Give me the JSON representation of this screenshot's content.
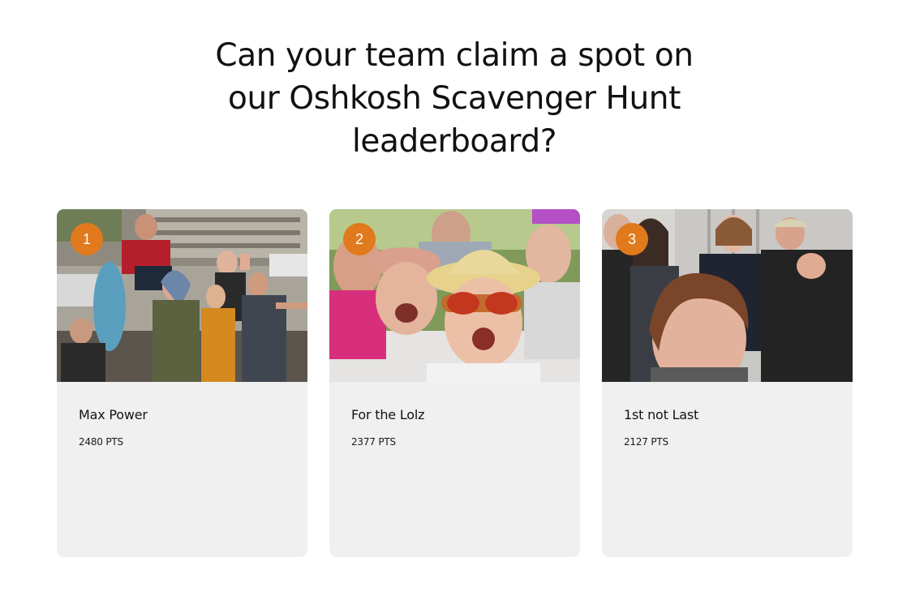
{
  "heading": {
    "line1": "Can your team claim a spot on",
    "line2": "our Oshkosh Scavenger Hunt",
    "line3": "leaderboard?"
  },
  "leaderboard": [
    {
      "rank": "1",
      "team": "Max Power",
      "points": "2480 PTS"
    },
    {
      "rank": "2",
      "team": "For the Lolz",
      "points": "2377 PTS"
    },
    {
      "rank": "3",
      "team": "1st not Last",
      "points": "2127 PTS"
    }
  ],
  "colors": {
    "badge": "#e07a1c",
    "card_background": "#f0f0f0",
    "text": "#111111"
  }
}
